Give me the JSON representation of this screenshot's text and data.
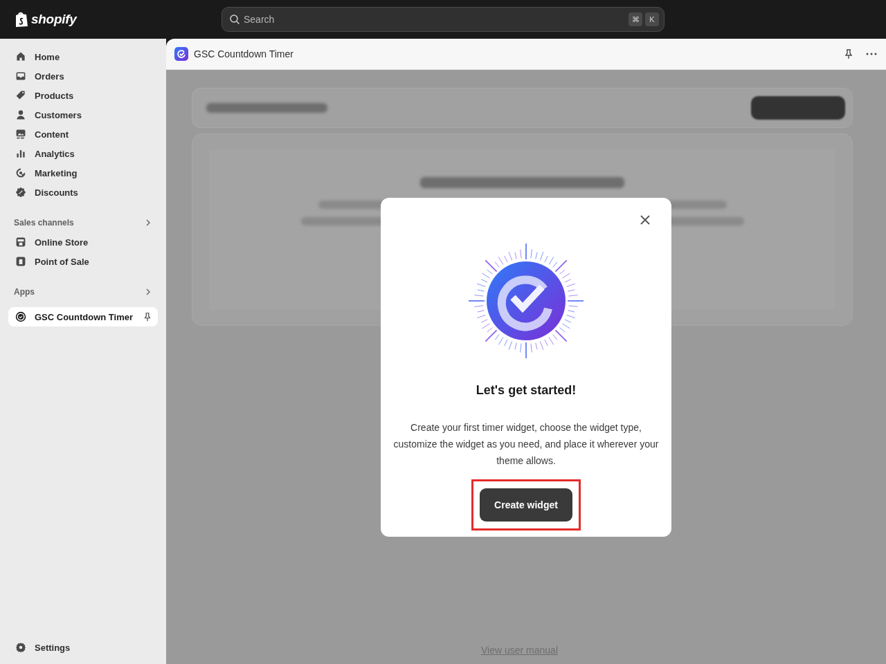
{
  "topbar": {
    "logo": "shopify",
    "search": {
      "placeholder": "Search"
    },
    "shortcut_keys": [
      "⌘",
      "K"
    ]
  },
  "sidebar": {
    "items": [
      {
        "label": "Home",
        "selected": false
      },
      {
        "label": "Orders",
        "selected": false
      },
      {
        "label": "Products",
        "selected": false
      },
      {
        "label": "Customers",
        "selected": false
      },
      {
        "label": "Content",
        "selected": false
      },
      {
        "label": "Analytics",
        "selected": false
      },
      {
        "label": "Marketing",
        "selected": false
      },
      {
        "label": "Discounts",
        "selected": false
      }
    ],
    "sales_channels": {
      "title": "Sales channels",
      "items": [
        {
          "label": "Online Store",
          "selected": false
        },
        {
          "label": "Point of Sale",
          "selected": false
        }
      ]
    },
    "apps": {
      "title": "Apps",
      "items": [
        {
          "label": "GSC Countdown Timer",
          "selected": true
        }
      ]
    },
    "settings": {
      "label": "Settings"
    }
  },
  "app_header": {
    "title": "GSC Countdown Timer"
  },
  "modal": {
    "title": "Let's get started!",
    "body": "Create your first timer widget, choose the widget type, customize the widget as you need, and place it wherever your theme allows.",
    "button": "Create widget"
  },
  "footer_link": "View user manual"
}
